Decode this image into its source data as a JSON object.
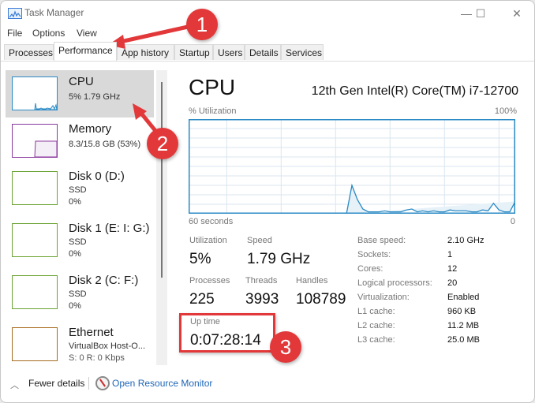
{
  "window": {
    "title": "Task Manager",
    "controls": {
      "minimize": "—",
      "maximize": "☐",
      "close": "✕"
    }
  },
  "menu": [
    "File",
    "Options",
    "View"
  ],
  "tabs": [
    {
      "label": "Processes",
      "active": false
    },
    {
      "label": "Performance",
      "active": true
    },
    {
      "label": "App history",
      "active": false
    },
    {
      "label": "Startup",
      "active": false
    },
    {
      "label": "Users",
      "active": false
    },
    {
      "label": "Details",
      "active": false
    },
    {
      "label": "Services",
      "active": false
    }
  ],
  "sidebar": {
    "items": [
      {
        "name": "CPU",
        "line1": "5%  1.79 GHz",
        "line2": "",
        "color": "#2a8ac4",
        "selected": true
      },
      {
        "name": "Memory",
        "line1": "8.3/15.8 GB (53%)",
        "line2": "",
        "color": "#8b3a9e",
        "selected": false
      },
      {
        "name": "Disk 0 (D:)",
        "line1": "SSD",
        "line2": "0%",
        "color": "#6aa332",
        "selected": false
      },
      {
        "name": "Disk 1 (E: I: G:)",
        "line1": "SSD",
        "line2": "0%",
        "color": "#6aa332",
        "selected": false
      },
      {
        "name": "Disk 2 (C: F:)",
        "line1": "SSD",
        "line2": "0%",
        "color": "#6aa332",
        "selected": false
      },
      {
        "name": "Ethernet",
        "line1": "VirtualBox Host-O...",
        "line2": "S: 0 R: 0 Kbps",
        "color": "#a66a1f",
        "selected": false
      }
    ]
  },
  "main": {
    "title": "CPU",
    "model": "12th Gen Intel(R) Core(TM) i7-12700",
    "util_label": "% Utilization",
    "util_max": "100%",
    "axis_left": "60 seconds",
    "axis_right": "0",
    "stats": {
      "utilization_label": "Utilization",
      "utilization": "5%",
      "speed_label": "Speed",
      "speed": "1.79 GHz",
      "processes_label": "Processes",
      "processes": "225",
      "threads_label": "Threads",
      "threads": "3993",
      "handles_label": "Handles",
      "handles": "108789",
      "uptime_label": "Up time",
      "uptime": "0:07:28:14"
    },
    "specs": [
      {
        "label": "Base speed:",
        "value": "2.10 GHz"
      },
      {
        "label": "Sockets:",
        "value": "1"
      },
      {
        "label": "Cores:",
        "value": "12"
      },
      {
        "label": "Logical processors:",
        "value": "20"
      },
      {
        "label": "Virtualization:",
        "value": "Enabled"
      },
      {
        "label": "L1 cache:",
        "value": "960 KB"
      },
      {
        "label": "L2 cache:",
        "value": "11.2 MB"
      },
      {
        "label": "L3 cache:",
        "value": "25.0 MB"
      }
    ]
  },
  "chart_data": {
    "type": "area",
    "title": "% Utilization",
    "xlabel": "60 seconds",
    "ylabel": "% Utilization",
    "xlim": [
      60,
      0
    ],
    "ylim": [
      0,
      100
    ],
    "grid": true,
    "x": [
      60,
      59,
      58,
      57,
      56,
      55,
      54,
      53,
      52,
      51,
      50,
      49,
      48,
      47,
      46,
      45,
      44,
      43,
      42,
      41,
      40,
      39,
      38,
      37,
      36,
      35,
      34,
      33,
      32,
      31,
      30,
      29,
      28,
      27,
      26,
      25,
      24,
      23,
      22,
      21,
      20,
      19,
      18,
      17,
      16,
      15,
      14,
      13,
      12,
      11,
      10,
      9,
      8,
      7,
      6,
      5,
      4,
      3,
      2,
      1,
      0
    ],
    "series": [
      {
        "name": "CPU",
        "color": "#2a8ac4",
        "values": [
          null,
          null,
          null,
          null,
          null,
          null,
          null,
          null,
          null,
          null,
          null,
          null,
          null,
          null,
          null,
          null,
          null,
          null,
          null,
          null,
          null,
          null,
          null,
          null,
          null,
          null,
          null,
          null,
          null,
          0,
          30,
          15,
          5,
          2,
          2,
          2,
          3,
          2,
          2,
          2,
          4,
          5,
          2,
          3,
          2,
          3,
          2,
          2,
          4,
          3,
          3,
          3,
          2,
          2,
          4,
          3,
          11,
          4,
          2,
          2,
          13,
          6
        ]
      }
    ]
  },
  "footer": {
    "fewer_details": "Fewer details",
    "resource_monitor": "Open Resource Monitor"
  },
  "annotations": [
    "1",
    "2",
    "3"
  ]
}
